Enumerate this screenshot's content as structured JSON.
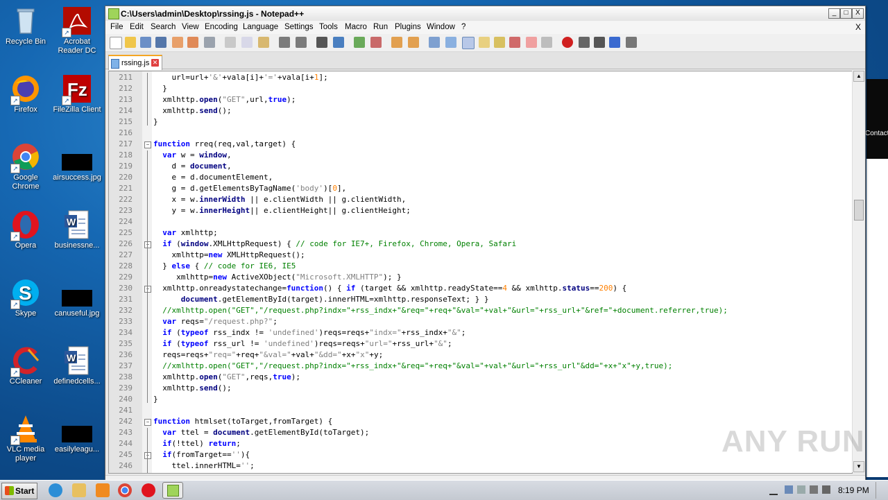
{
  "desktop": {
    "icons": [
      {
        "label": "Recycle Bin",
        "icon": "recycle-bin-icon"
      },
      {
        "label": "Acrobat Reader DC",
        "icon": "acrobat-icon"
      },
      {
        "label": "Firefox",
        "icon": "firefox-icon"
      },
      {
        "label": "FileZilla Client",
        "icon": "filezilla-icon"
      },
      {
        "label": "Google Chrome",
        "icon": "chrome-icon"
      },
      {
        "label": "airsuccess.jpg",
        "icon": "image-file-icon"
      },
      {
        "label": "Opera",
        "icon": "opera-icon"
      },
      {
        "label": "businessne...",
        "icon": "word-doc-icon"
      },
      {
        "label": "Skype",
        "icon": "skype-icon"
      },
      {
        "label": "canuseful.jpg",
        "icon": "image-file-icon"
      },
      {
        "label": "CCleaner",
        "icon": "ccleaner-icon"
      },
      {
        "label": "definedcells...",
        "icon": "word-doc-icon"
      },
      {
        "label": "VLC media player",
        "icon": "vlc-icon"
      },
      {
        "label": "easilyleagu...",
        "icon": "image-file-icon"
      }
    ],
    "bg_window_text": "Contact"
  },
  "window": {
    "title": "C:\\Users\\admin\\Desktop\\rssing.js - Notepad++",
    "min": "_",
    "max": "□",
    "close": "X",
    "menu": [
      "File",
      "Edit",
      "Search",
      "View",
      "Encoding",
      "Language",
      "Settings",
      "Tools",
      "Macro",
      "Run",
      "Plugins",
      "Window",
      "?"
    ],
    "menu_close": "X",
    "tab_label": "rssing.js",
    "tab_close": "✕"
  },
  "editor": {
    "first_line": 211,
    "lines": [
      "    url=url+'&'+vala[i]+'='+vala[i+1];",
      "  }",
      "  xmlhttp.open(\"GET\",url,true);",
      "  xmlhttp.send();",
      "}",
      "",
      "function rreq(req,val,target) {",
      "  var w = window,",
      "    d = document,",
      "    e = d.documentElement,",
      "    g = d.getElementsByTagName('body')[0],",
      "    x = w.innerWidth || e.clientWidth || g.clientWidth,",
      "    y = w.innerHeight|| e.clientHeight|| g.clientHeight;",
      "",
      "  var xmlhttp;",
      "  if (window.XMLHttpRequest) { // code for IE7+, Firefox, Chrome, Opera, Safari",
      "    xmlhttp=new XMLHttpRequest();",
      "  } else { // code for IE6, IE5",
      "     xmlhttp=new ActiveXObject(\"Microsoft.XMLHTTP\"); }",
      "  xmlhttp.onreadystatechange=function() { if (target && xmlhttp.readyState==4 && xmlhttp.status==200) {",
      "      document.getElementById(target).innerHTML=xmlhttp.responseText; } }",
      "  //xmlhttp.open(\"GET\",\"/request.php?indx=\"+rss_indx+\"&req=\"+req+\"&val=\"+val+\"&url=\"+rss_url+\"&ref=\"+document.referrer,true);",
      "  var reqs=\"/request.php?\";",
      "  if (typeof rss_indx != 'undefined')reqs=reqs+\"indx=\"+rss_indx+\"&\";",
      "  if (typeof rss_url != 'undefined')reqs=reqs+\"url=\"+rss_url+\"&\";",
      "  reqs=reqs+\"req=\"+req+\"&val=\"+val+\"&dd=\"+x+\"x\"+y;",
      "  //xmlhttp.open(\"GET\",\"/request.php?indx=\"+rss_indx+\"&req=\"+req+\"&val=\"+val+\"&url=\"+rss_url\"&dd=\"+x+\"x\"+y,true);",
      "  xmlhttp.open(\"GET\",reqs,true);",
      "  xmlhttp.send();",
      "}",
      "",
      "function htmlset(toTarget,fromTarget) {",
      "  var ttel = document.getElementById(toTarget);",
      "  if(!ttel) return;",
      "  if(fromTarget==''){",
      "    ttel.innerHTML='';"
    ]
  },
  "watermark": "ANY RUN",
  "taskbar": {
    "start_label": "Start",
    "clock": "8:19 PM"
  }
}
